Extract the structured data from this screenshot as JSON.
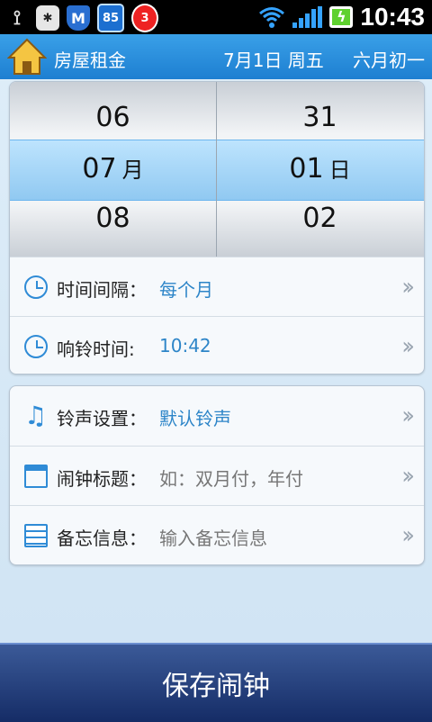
{
  "status_bar": {
    "badge_count": "85",
    "alarm_count": "3",
    "time": "10:43"
  },
  "header": {
    "title": "房屋租金",
    "date": "7月1日 周五",
    "lunar": "六月初一"
  },
  "picker": {
    "month": {
      "prev": "06",
      "selected": "07",
      "next": "08",
      "unit": "月"
    },
    "day": {
      "prev": "31",
      "selected": "01",
      "next": "02",
      "unit": "日"
    }
  },
  "settings_group1": [
    {
      "label": "时间间隔：",
      "value": "每个月",
      "icon": "clock-icon"
    },
    {
      "label": "响铃时间:",
      "value": "10:42",
      "icon": "clock-icon"
    }
  ],
  "settings_group2": [
    {
      "label": "铃声设置：",
      "value": "默认铃声",
      "icon": "music-note-icon"
    },
    {
      "label": "闹钟标题：",
      "placeholder": "如：双月付，年付",
      "icon": "film-icon"
    },
    {
      "label": "备忘信息：",
      "placeholder": "输入备忘信息",
      "icon": "note-icon"
    }
  ],
  "save_button": {
    "label": "保存闹钟"
  },
  "colors": {
    "header": "#2b8fdc",
    "accent": "#2d85c8",
    "save": "#1e3a7a"
  }
}
